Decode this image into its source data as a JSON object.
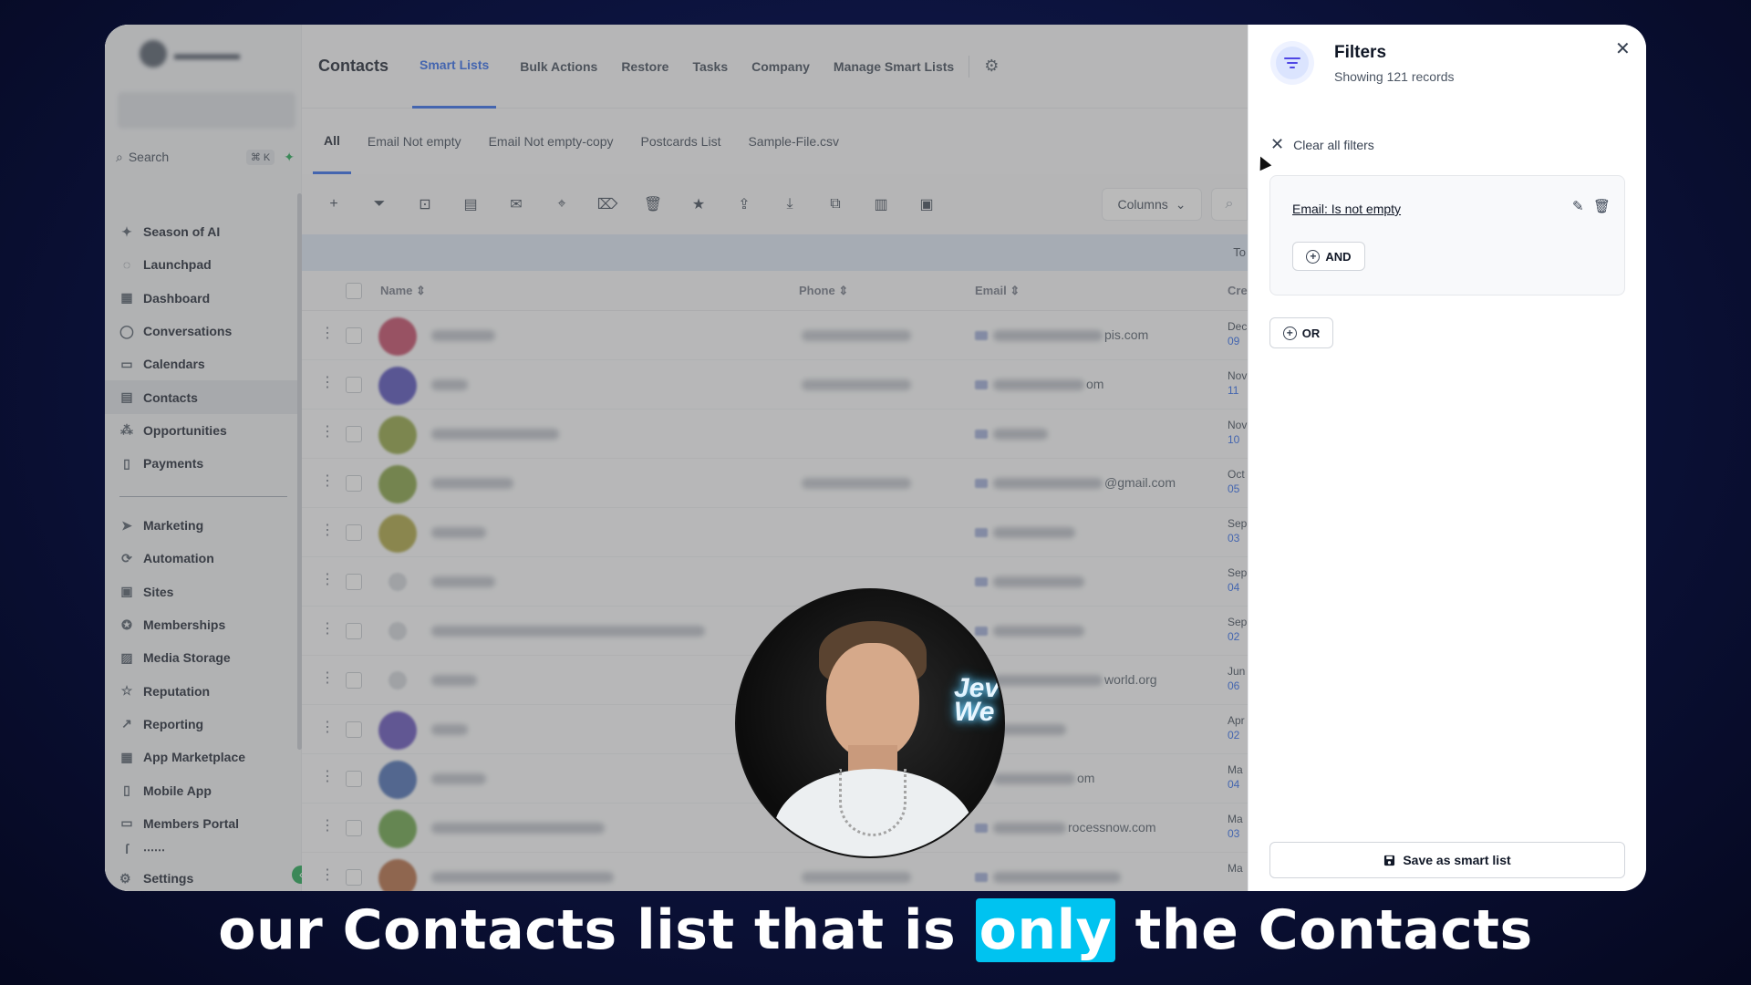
{
  "sidebar": {
    "search_label": "Search",
    "search_shortcut": "⌘ K",
    "items_group1": [
      {
        "label": "Season of AI",
        "icon": "sparkle-icon",
        "glyph": "✦"
      },
      {
        "label": "Launchpad",
        "icon": "rocket-icon",
        "glyph": "◌"
      },
      {
        "label": "Dashboard",
        "icon": "dashboard-icon",
        "glyph": "▦"
      },
      {
        "label": "Conversations",
        "icon": "chat-icon",
        "glyph": "◯"
      },
      {
        "label": "Calendars",
        "icon": "calendar-icon",
        "glyph": "▭"
      },
      {
        "label": "Contacts",
        "icon": "contacts-icon",
        "glyph": "▤",
        "active": true
      },
      {
        "label": "Opportunities",
        "icon": "opportunities-icon",
        "glyph": "⁂"
      },
      {
        "label": "Payments",
        "icon": "payments-icon",
        "glyph": "▯"
      }
    ],
    "items_group2": [
      {
        "label": "Marketing",
        "icon": "send-icon",
        "glyph": "➤"
      },
      {
        "label": "Automation",
        "icon": "automation-icon",
        "glyph": "⟳"
      },
      {
        "label": "Sites",
        "icon": "sites-icon",
        "glyph": "▣"
      },
      {
        "label": "Memberships",
        "icon": "award-icon",
        "glyph": "✪"
      },
      {
        "label": "Media Storage",
        "icon": "image-icon",
        "glyph": "▨"
      },
      {
        "label": "Reputation",
        "icon": "star-icon",
        "glyph": "☆"
      },
      {
        "label": "Reporting",
        "icon": "trend-icon",
        "glyph": "↗"
      },
      {
        "label": "App Marketplace",
        "icon": "grid-icon",
        "glyph": "▦"
      },
      {
        "label": "Mobile App",
        "icon": "mobile-icon",
        "glyph": "▯"
      },
      {
        "label": "Members Portal",
        "icon": "monitor-icon",
        "glyph": "▭"
      }
    ],
    "settings_label": "Settings"
  },
  "topbar": {
    "title": "Contacts",
    "tabs": [
      "Smart Lists",
      "Bulk Actions",
      "Restore",
      "Tasks",
      "Company",
      "Manage Smart Lists"
    ],
    "active_tab": "Smart Lists"
  },
  "subtabs": [
    "All",
    "Email Not empty",
    "Email Not empty-copy",
    "Postcards List",
    "Sample-File.csv"
  ],
  "toolbar": {
    "tools": [
      "add-icon",
      "filter-icon",
      "robot-icon",
      "message-icon",
      "email-icon",
      "tag-add-icon",
      "tag-remove-icon",
      "trash-icon",
      "star-icon",
      "upload-icon",
      "download-icon",
      "duplicate-icon",
      "company-icon",
      "image-icon"
    ],
    "columns_label": "Columns",
    "band_text": "To"
  },
  "table": {
    "headers": {
      "name": "Name",
      "phone": "Phone",
      "email": "Email",
      "created": "Cre"
    },
    "rows": [
      {
        "avatar": "#c0405f",
        "email_visible": "pis.com",
        "date1": "Dec",
        "date2": "09",
        "has_phone": true
      },
      {
        "avatar": "#4c46b8",
        "email_visible": "om",
        "date1": "Nov",
        "date2": "11",
        "has_phone": true
      },
      {
        "avatar": "#8ca03a",
        "email_visible": "",
        "date1": "Nov",
        "date2": "10",
        "has_phone": false
      },
      {
        "avatar": "#7e9c3a",
        "email_visible": "@gmail.com",
        "date1": "Oct",
        "date2": "05",
        "has_phone": true
      },
      {
        "avatar": "#a7a038",
        "email_visible": "",
        "date1": "Sep",
        "date2": "03",
        "has_phone": false
      },
      {
        "avatar": "",
        "email_visible": "",
        "date1": "Sep",
        "date2": "04",
        "has_phone": false
      },
      {
        "avatar": "",
        "email_visible": "",
        "date1": "Sep",
        "date2": "02",
        "has_phone": false
      },
      {
        "avatar": "",
        "email_visible": "world.org",
        "date1": "Jun",
        "date2": "06",
        "has_phone": false
      },
      {
        "avatar": "#5c48b8",
        "email_visible": "",
        "date1": "Apr",
        "date2": "02",
        "has_phone": false
      },
      {
        "avatar": "#4167b0",
        "email_visible": "om",
        "date1": "Ma",
        "date2": "04",
        "has_phone": false
      },
      {
        "avatar": "#63a040",
        "email_visible": "rocessnow.com",
        "date1": "Ma",
        "date2": "03",
        "has_phone": false
      },
      {
        "avatar": "#b0643a",
        "email_visible": "",
        "date1": "Ma",
        "date2": "",
        "has_phone": true
      }
    ]
  },
  "filters_panel": {
    "title": "Filters",
    "subtitle": "Showing 121 records",
    "clear_all_label": "Clear all filters",
    "condition": "Email:  Is not empty",
    "and_label": "AND",
    "or_label": "OR",
    "save_label": "Save as smart list"
  },
  "webcam": {
    "neon_text_line1": "Jev",
    "neon_text_line2": "We"
  },
  "caption": {
    "before": "our Contacts list that is ",
    "highlight": "only",
    "after": " the Contacts",
    "highlight_color": "#00c3f0"
  },
  "colors": {
    "accent": "#2563eb",
    "success": "#16a34a"
  }
}
